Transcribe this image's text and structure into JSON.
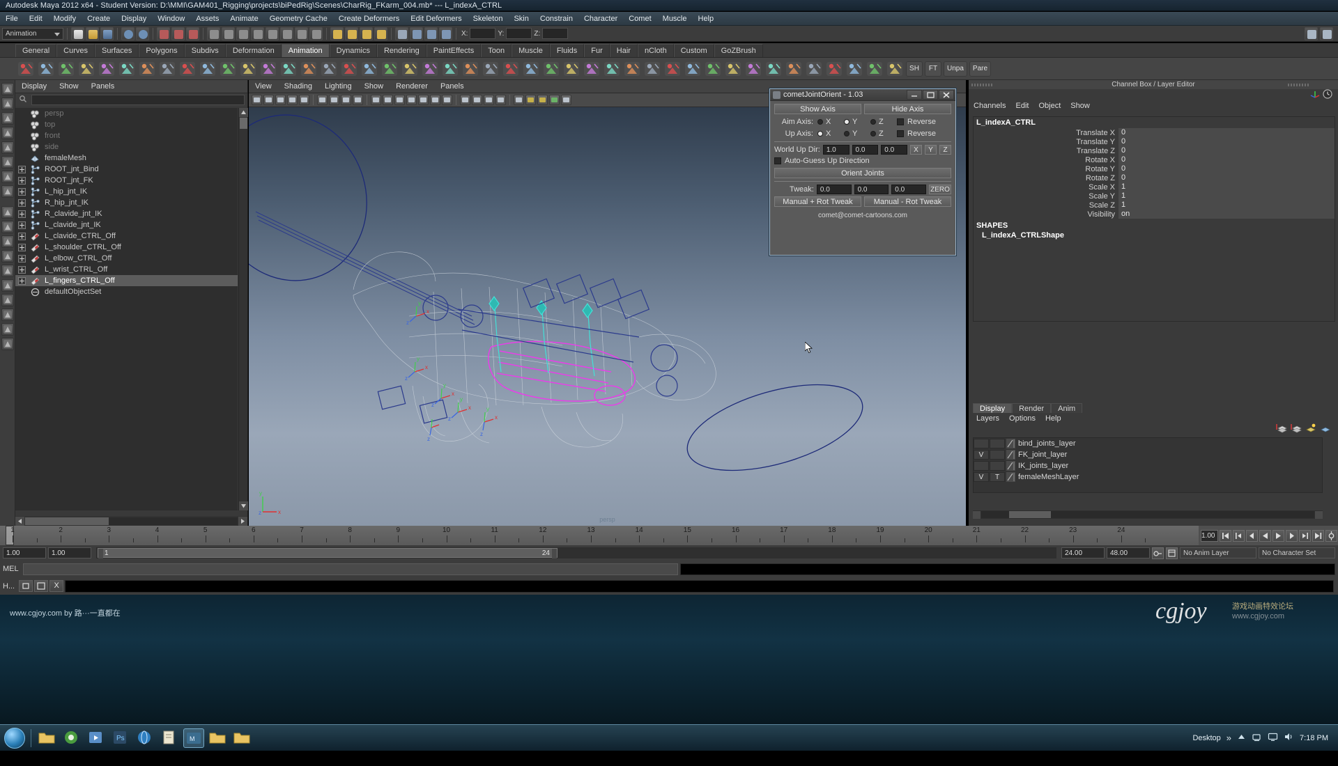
{
  "window": {
    "title": "Autodesk Maya 2012 x64 - Student Version: D:\\MMI\\GAM401_Rigging\\projects\\biPedRig\\Scenes\\CharRig_FKarm_004.mb*   ---   L_indexA_CTRL"
  },
  "menubar": {
    "items": [
      "File",
      "Edit",
      "Modify",
      "Create",
      "Display",
      "Window",
      "Assets",
      "Animate",
      "Geometry Cache",
      "Create Deformers",
      "Edit Deformers",
      "Skeleton",
      "Skin",
      "Constrain",
      "Character",
      "Comet",
      "Muscle",
      "Help"
    ]
  },
  "statusline": {
    "menuset": "Animation",
    "coord_labels": [
      "X:",
      "Y:",
      "Z:"
    ]
  },
  "shelf": {
    "tabs": [
      "General",
      "Curves",
      "Surfaces",
      "Polygons",
      "Subdivs",
      "Deformation",
      "Animation",
      "Dynamics",
      "Rendering",
      "PaintEffects",
      "Toon",
      "Muscle",
      "Fluids",
      "Fur",
      "Hair",
      "nCloth",
      "Custom",
      "GoZBrush"
    ],
    "active_tab": "Animation",
    "button_labels": [
      "SH",
      "FT",
      "Unpa",
      "Pare"
    ]
  },
  "outliner": {
    "menu": [
      "Display",
      "Show",
      "Panels"
    ],
    "search_placeholder": "",
    "items": [
      {
        "label": "persp",
        "icon": "camera-icon",
        "expandable": false,
        "dim": true,
        "selected": false
      },
      {
        "label": "top",
        "icon": "camera-icon",
        "expandable": false,
        "dim": true,
        "selected": false
      },
      {
        "label": "front",
        "icon": "camera-icon",
        "expandable": false,
        "dim": true,
        "selected": false
      },
      {
        "label": "side",
        "icon": "camera-icon",
        "expandable": false,
        "dim": true,
        "selected": false
      },
      {
        "label": "femaleMesh",
        "icon": "mesh-icon",
        "expandable": false,
        "dim": false,
        "selected": false
      },
      {
        "label": "ROOT_jnt_Bind",
        "icon": "joint-icon",
        "expandable": true,
        "dim": false,
        "selected": false
      },
      {
        "label": "ROOT_jnt_FK",
        "icon": "joint-icon",
        "expandable": true,
        "dim": false,
        "selected": false
      },
      {
        "label": "L_hip_jnt_IK",
        "icon": "joint-icon",
        "expandable": true,
        "dim": false,
        "selected": false
      },
      {
        "label": "R_hip_jnt_IK",
        "icon": "joint-icon",
        "expandable": true,
        "dim": false,
        "selected": false
      },
      {
        "label": "R_clavide_jnt_IK",
        "icon": "joint-icon",
        "expandable": true,
        "dim": false,
        "selected": false
      },
      {
        "label": "L_clavide_jnt_IK",
        "icon": "joint-icon",
        "expandable": true,
        "dim": false,
        "selected": false
      },
      {
        "label": "L_clavide_CTRL_Off",
        "icon": "transform-icon",
        "expandable": true,
        "dim": false,
        "selected": false
      },
      {
        "label": "L_shoulder_CTRL_Off",
        "icon": "transform-icon",
        "expandable": true,
        "dim": false,
        "selected": false
      },
      {
        "label": "L_elbow_CTRL_Off",
        "icon": "transform-icon",
        "expandable": true,
        "dim": false,
        "selected": false
      },
      {
        "label": "L_wrist_CTRL_Off",
        "icon": "transform-icon",
        "expandable": true,
        "dim": false,
        "selected": false
      },
      {
        "label": "L_fingers_CTRL_Off",
        "icon": "transform-icon",
        "expandable": true,
        "dim": false,
        "selected": true
      },
      {
        "label": "defaultObjectSet",
        "icon": "set-icon",
        "expandable": false,
        "dim": false,
        "selected": false
      }
    ]
  },
  "viewport": {
    "menu": [
      "View",
      "Shading",
      "Lighting",
      "Show",
      "Renderer",
      "Panels"
    ],
    "axis_labels": {
      "x": "x",
      "y": "y",
      "z": "z"
    },
    "footer_label": "persp"
  },
  "comet_dialog": {
    "title": "cometJointOrient - 1.03",
    "show_axis": "Show Axis",
    "hide_axis": "Hide Axis",
    "aim_axis_label": "Aim Axis:",
    "up_axis_label": "Up  Axis:",
    "axes": [
      "X",
      "Y",
      "Z"
    ],
    "aim_axis_selected": "Y",
    "up_axis_selected": "X",
    "reverse_label": "Reverse",
    "world_up_dir_label": "World Up Dir:",
    "world_up_dir": [
      "1.0",
      "0.0",
      "0.0"
    ],
    "quick_axis_buttons": [
      "X",
      "Y",
      "Z"
    ],
    "auto_guess_label": "Auto-Guess Up Direction",
    "orient_joints": "Orient Joints",
    "tweak_label": "Tweak:",
    "tweak_values": [
      "0.0",
      "0.0",
      "0.0"
    ],
    "zero_label": "ZERO",
    "manual_plus": "Manual + Rot Tweak",
    "manual_minus": "Manual - Rot Tweak",
    "email": "comet@comet-cartoons.com"
  },
  "channelbox": {
    "header": "Channel Box / Layer Editor",
    "menu": [
      "Channels",
      "Edit",
      "Object",
      "Show"
    ],
    "node_name": "L_indexA_CTRL",
    "attributes": [
      {
        "name": "Translate X",
        "value": "0"
      },
      {
        "name": "Translate Y",
        "value": "0"
      },
      {
        "name": "Translate Z",
        "value": "0"
      },
      {
        "name": "Rotate X",
        "value": "0"
      },
      {
        "name": "Rotate Y",
        "value": "0"
      },
      {
        "name": "Rotate Z",
        "value": "0"
      },
      {
        "name": "Scale X",
        "value": "1"
      },
      {
        "name": "Scale Y",
        "value": "1"
      },
      {
        "name": "Scale Z",
        "value": "1"
      },
      {
        "name": "Visibility",
        "value": "on"
      }
    ],
    "shapes_label": "SHAPES",
    "shape_name": "L_indexA_CTRLShape"
  },
  "layer_editor": {
    "tabs": [
      "Display",
      "Render",
      "Anim"
    ],
    "active_tab": "Display",
    "menu": [
      "Layers",
      "Options",
      "Help"
    ],
    "layers": [
      {
        "visible": "",
        "type": "",
        "name": "bind_joints_layer",
        "color": "#6d6d6d"
      },
      {
        "visible": "V",
        "type": "",
        "name": "FK_joint_layer",
        "color": "#6d6d6d"
      },
      {
        "visible": "",
        "type": "",
        "name": "IK_joints_layer",
        "color": "#6d6d6d"
      },
      {
        "visible": "V",
        "type": "T",
        "name": "femaleMeshLayer",
        "color": "#6d6d6d"
      }
    ]
  },
  "timeline": {
    "ticks": [
      "1",
      "2",
      "3",
      "4",
      "5",
      "6",
      "7",
      "8",
      "9",
      "10",
      "11",
      "12",
      "13",
      "14",
      "15",
      "16",
      "17",
      "18",
      "19",
      "20",
      "21",
      "22",
      "23",
      "24"
    ],
    "current_frame": "1.00",
    "current_frame_field": "1.00"
  },
  "range_slider": {
    "start": "1.00",
    "end": "1.00",
    "range_start": "1",
    "range_end": "24",
    "playback_start": "24.00",
    "playback_end": "48.00",
    "anim_layer": "No Anim Layer",
    "character_set": "No Character Set"
  },
  "mel": {
    "label": "MEL",
    "input_value": "",
    "output_value": ""
  },
  "helpline": {
    "window_label": "H...",
    "close_label": "X"
  },
  "desktop": {
    "watermark": "www.cgjoy.com by 路···一直都在",
    "logo": "cgjoy"
  },
  "taskbar": {
    "desktop_label": "Desktop",
    "clock": "7:18 PM"
  },
  "colors": {
    "accent_blue": "#5a7fa8",
    "selection_gray": "#5c5c5c",
    "magenta_curve": "#e83fe8",
    "cyan_joint": "#44e0d8",
    "dark_blue_curve": "#2b3a8c"
  }
}
